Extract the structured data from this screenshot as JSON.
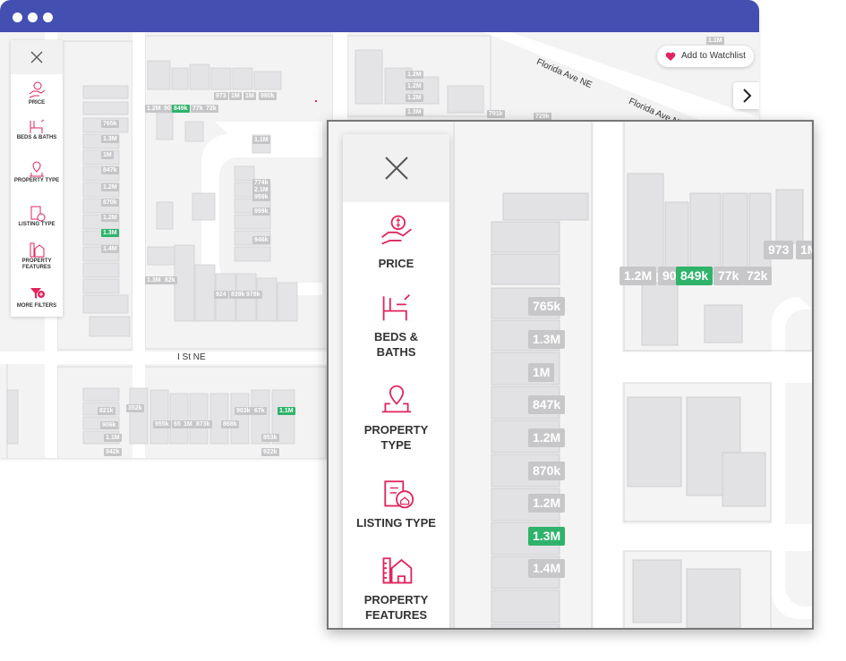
{
  "colors": {
    "titlebar": "#4350b1",
    "accent": "#e0245e",
    "price_label": "#c6c6c8",
    "highlight_label": "#2fb36a"
  },
  "window": {
    "controls": [
      "window-dot",
      "window-dot",
      "window-dot"
    ]
  },
  "watchlist": {
    "label": "Add to Watchlist",
    "icon": "heart-icon"
  },
  "next_button": {
    "icon": "chevron-right-icon"
  },
  "streets": [
    "Florida Ave NE",
    "Florida Ave NE",
    "I St NE"
  ],
  "filters": [
    {
      "label": "PRICE",
      "icon": "price-hand-coin-icon"
    },
    {
      "label": "BEDS & BATHS",
      "icon": "bed-bath-icon"
    },
    {
      "label": "PROPERTY TYPE",
      "icon": "house-pin-icon"
    },
    {
      "label": "LISTING TYPE",
      "icon": "clipboard-house-icon"
    },
    {
      "label": "PROPERTY FEATURES",
      "icon": "ruler-house-icon"
    },
    {
      "label": "MORE FILTERS",
      "icon": "filter-plus-icon"
    }
  ],
  "zoom_filters": [
    {
      "label": "PRICE"
    },
    {
      "label": "BEDS & BATHS"
    },
    {
      "label": "PROPERTY TYPE"
    },
    {
      "label": "LISTING TYPE"
    },
    {
      "label": "PROPERTY FEATURES"
    }
  ],
  "map_labels": [
    {
      "text": "1.2M"
    },
    {
      "text": "1.2M"
    },
    {
      "text": "1.2M"
    },
    {
      "text": "1.3M"
    },
    {
      "text": "1.1M"
    },
    {
      "text": "973"
    },
    {
      "text": "1M"
    },
    {
      "text": "1M"
    },
    {
      "text": "980k"
    },
    {
      "text": "1.2M"
    },
    {
      "text": "90"
    },
    {
      "text": "849k",
      "highlight": true
    },
    {
      "text": "77k"
    },
    {
      "text": "72k"
    },
    {
      "text": "791k"
    },
    {
      "text": "729k"
    },
    {
      "text": "765k"
    },
    {
      "text": "1.3M"
    },
    {
      "text": "1M"
    },
    {
      "text": "847k"
    },
    {
      "text": "1.2M"
    },
    {
      "text": "870k"
    },
    {
      "text": "1.2M"
    },
    {
      "text": "1.3M",
      "highlight": true
    },
    {
      "text": "1.4M"
    },
    {
      "text": "1.1M"
    },
    {
      "text": "774k"
    },
    {
      "text": "2.1M"
    },
    {
      "text": "959k"
    },
    {
      "text": "999k"
    },
    {
      "text": "946k"
    },
    {
      "text": "1.3M"
    },
    {
      "text": "82k"
    },
    {
      "text": "924"
    },
    {
      "text": "839k"
    },
    {
      "text": "978k"
    },
    {
      "text": "821k"
    },
    {
      "text": "352k"
    },
    {
      "text": "906k"
    },
    {
      "text": "955k"
    },
    {
      "text": "65"
    },
    {
      "text": "1M"
    },
    {
      "text": "873k"
    },
    {
      "text": "868k"
    },
    {
      "text": "903k"
    },
    {
      "text": "67k"
    },
    {
      "text": "1.1M",
      "highlight": true
    },
    {
      "text": "1.1M"
    },
    {
      "text": "942k"
    },
    {
      "text": "853k"
    },
    {
      "text": "922k"
    }
  ],
  "zoom_labels": [
    {
      "text": "973"
    },
    {
      "text": "1M"
    },
    {
      "text": "1.2M"
    },
    {
      "text": "90"
    },
    {
      "text": "849k",
      "highlight": true
    },
    {
      "text": "77k"
    },
    {
      "text": "72k"
    },
    {
      "text": "765k"
    },
    {
      "text": "1.3M"
    },
    {
      "text": "1M"
    },
    {
      "text": "847k"
    },
    {
      "text": "1.2M"
    },
    {
      "text": "870k"
    },
    {
      "text": "1.2M"
    },
    {
      "text": "1.3M",
      "highlight": true
    },
    {
      "text": "1.4M"
    }
  ]
}
